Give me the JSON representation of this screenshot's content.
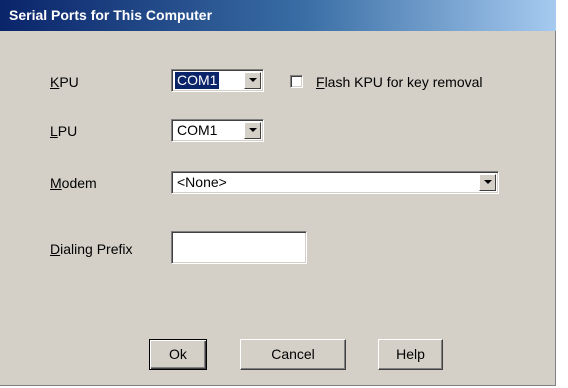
{
  "window": {
    "title": "Serial Ports for This Computer"
  },
  "kpu": {
    "label_key": "K",
    "label_rest": "PU",
    "value": "COM1"
  },
  "flash": {
    "label_key": "F",
    "label_rest": "lash KPU for key removal",
    "checked": false
  },
  "lpu": {
    "label_key": "L",
    "label_rest": "PU",
    "value": "COM1"
  },
  "modem": {
    "label_key": "M",
    "label_rest": "odem",
    "value": "<None>"
  },
  "dialing": {
    "label_key": "D",
    "label_rest": "ialing Prefix",
    "value": ""
  },
  "buttons": {
    "ok": "Ok",
    "cancel": "Cancel",
    "help": "Help"
  },
  "icons": {
    "dropdown": "chevron-down-icon"
  },
  "colors": {
    "face": "#d4d0c8",
    "title_start": "#0a246a",
    "title_end": "#a6caf0",
    "selection": "#0a246a"
  }
}
